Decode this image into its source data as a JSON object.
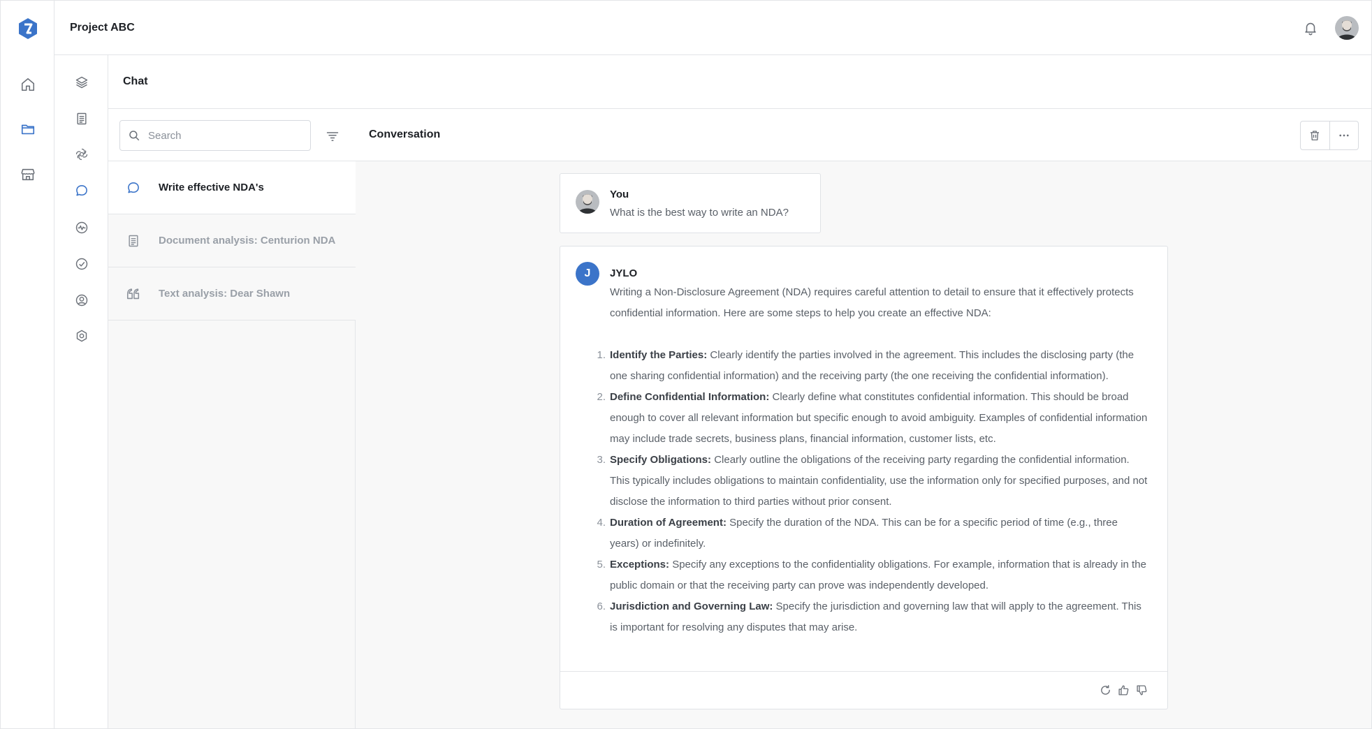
{
  "header": {
    "project_title": "Project ABC"
  },
  "rail": {
    "items": [
      {
        "name": "home",
        "icon": "home-icon"
      },
      {
        "name": "folder",
        "icon": "folder-icon",
        "active": true
      },
      {
        "name": "store",
        "icon": "store-icon"
      }
    ]
  },
  "iconcol": {
    "items": [
      {
        "name": "layers",
        "icon": "layers-icon"
      },
      {
        "name": "document",
        "icon": "document-icon"
      },
      {
        "name": "ai",
        "icon": "ai-knot-icon"
      },
      {
        "name": "chat",
        "icon": "chat-bubble-icon",
        "active": true
      },
      {
        "name": "activity",
        "icon": "activity-icon"
      },
      {
        "name": "check",
        "icon": "check-circle-icon"
      },
      {
        "name": "user",
        "icon": "user-circle-icon"
      },
      {
        "name": "settings",
        "icon": "settings-icon"
      }
    ]
  },
  "chat": {
    "section_title": "Chat",
    "search": {
      "placeholder": "Search",
      "value": ""
    },
    "conversations": [
      {
        "title": "Write effective NDA's",
        "icon": "chat-bubble-icon",
        "active": true
      },
      {
        "title": "Document analysis: Centurion NDA",
        "icon": "document-icon",
        "active": false
      },
      {
        "title": "Text analysis: Dear Shawn",
        "icon": "quote-icon",
        "active": false
      }
    ]
  },
  "conversation": {
    "title": "Conversation",
    "user_message": {
      "author": "You",
      "text": "What is the best way to write an NDA?"
    },
    "bot_message": {
      "author": "JYLO",
      "avatar_letter": "J",
      "intro": "Writing a Non-Disclosure Agreement (NDA) requires careful attention to detail to ensure that it effectively protects confidential information. Here are some steps to help you create an effective NDA:",
      "steps": [
        {
          "num": "1.",
          "title": "Identify the Parties:",
          "text": " Clearly identify the parties involved in the agreement. This includes the disclosing party (the one sharing confidential information) and the receiving party (the one receiving the confidential information)."
        },
        {
          "num": "2.",
          "title": "Define Confidential Information:",
          "text": " Clearly define what constitutes confidential information. This should be broad enough to cover all relevant information but specific enough to avoid ambiguity. Examples of confidential information may include trade secrets, business plans, financial information, customer lists, etc."
        },
        {
          "num": "3.",
          "title": "Specify Obligations:",
          "text": " Clearly outline the obligations of the receiving party regarding the confidential information. This typically includes obligations to maintain confidentiality, use the information only for specified purposes, and not disclose the information to third parties without prior consent."
        },
        {
          "num": "4.",
          "title": "Duration of Agreement:",
          "text": " Specify the duration of the NDA. This can be for a specific period of time (e.g., three years) or indefinitely."
        },
        {
          "num": "5.",
          "title": "Exceptions:",
          "text": " Specify any exceptions to the confidentiality obligations. For example, information that is already in the public domain or that the receiving party can prove was independently developed."
        },
        {
          "num": "6.",
          "title": "Jurisdiction and Governing Law:",
          "text": " Specify the jurisdiction and governing law that will apply to the agreement. This is important for resolving any disputes that may arise."
        }
      ]
    }
  },
  "colors": {
    "accent": "#3b74c9",
    "border": "#e3e5e8",
    "muted_text": "#9aa0a8",
    "pane_bg": "#f8f8f8"
  }
}
